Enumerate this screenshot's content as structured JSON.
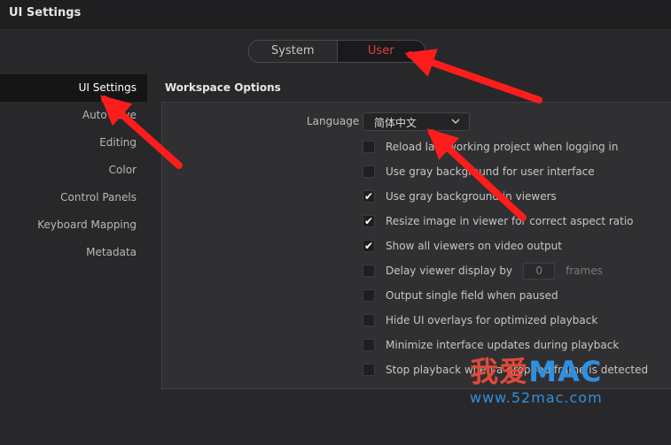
{
  "window": {
    "title": "UI Settings"
  },
  "segmented": {
    "options": [
      "System",
      "User"
    ],
    "active": "User"
  },
  "sidebar": {
    "items": [
      {
        "label": "UI Settings",
        "active": true
      },
      {
        "label": "Auto Save",
        "active": false
      },
      {
        "label": "Editing",
        "active": false
      },
      {
        "label": "Color",
        "active": false
      },
      {
        "label": "Control Panels",
        "active": false
      },
      {
        "label": "Keyboard Mapping",
        "active": false
      },
      {
        "label": "Metadata",
        "active": false
      }
    ]
  },
  "workspace": {
    "title": "Workspace Options",
    "language": {
      "label": "Language",
      "value": "简体中文"
    },
    "options": [
      {
        "label": "Reload last working project when logging in",
        "checked": false
      },
      {
        "label": "Use gray background for user interface",
        "checked": false
      },
      {
        "label": "Use gray background in viewers",
        "checked": true
      },
      {
        "label": "Resize image in viewer for correct aspect ratio",
        "checked": true
      },
      {
        "label": "Show all viewers on video output",
        "checked": true
      },
      {
        "label": "Delay viewer display by",
        "checked": false,
        "input_value": "0",
        "unit": "frames"
      },
      {
        "label": "Output single field when paused",
        "checked": false
      },
      {
        "label": "Hide UI overlays for optimized playback",
        "checked": false
      },
      {
        "label": "Minimize interface updates during playback",
        "checked": false
      },
      {
        "label": "Stop playback when a dropped frame is detected",
        "checked": false
      }
    ]
  },
  "watermark": {
    "cn": "我爱",
    "en": "MAC",
    "url": "www.52mac.com"
  },
  "colors": {
    "accent": "#e0423a",
    "arrow": "#ff1c1c",
    "brand_blue": "#2f90e0"
  }
}
